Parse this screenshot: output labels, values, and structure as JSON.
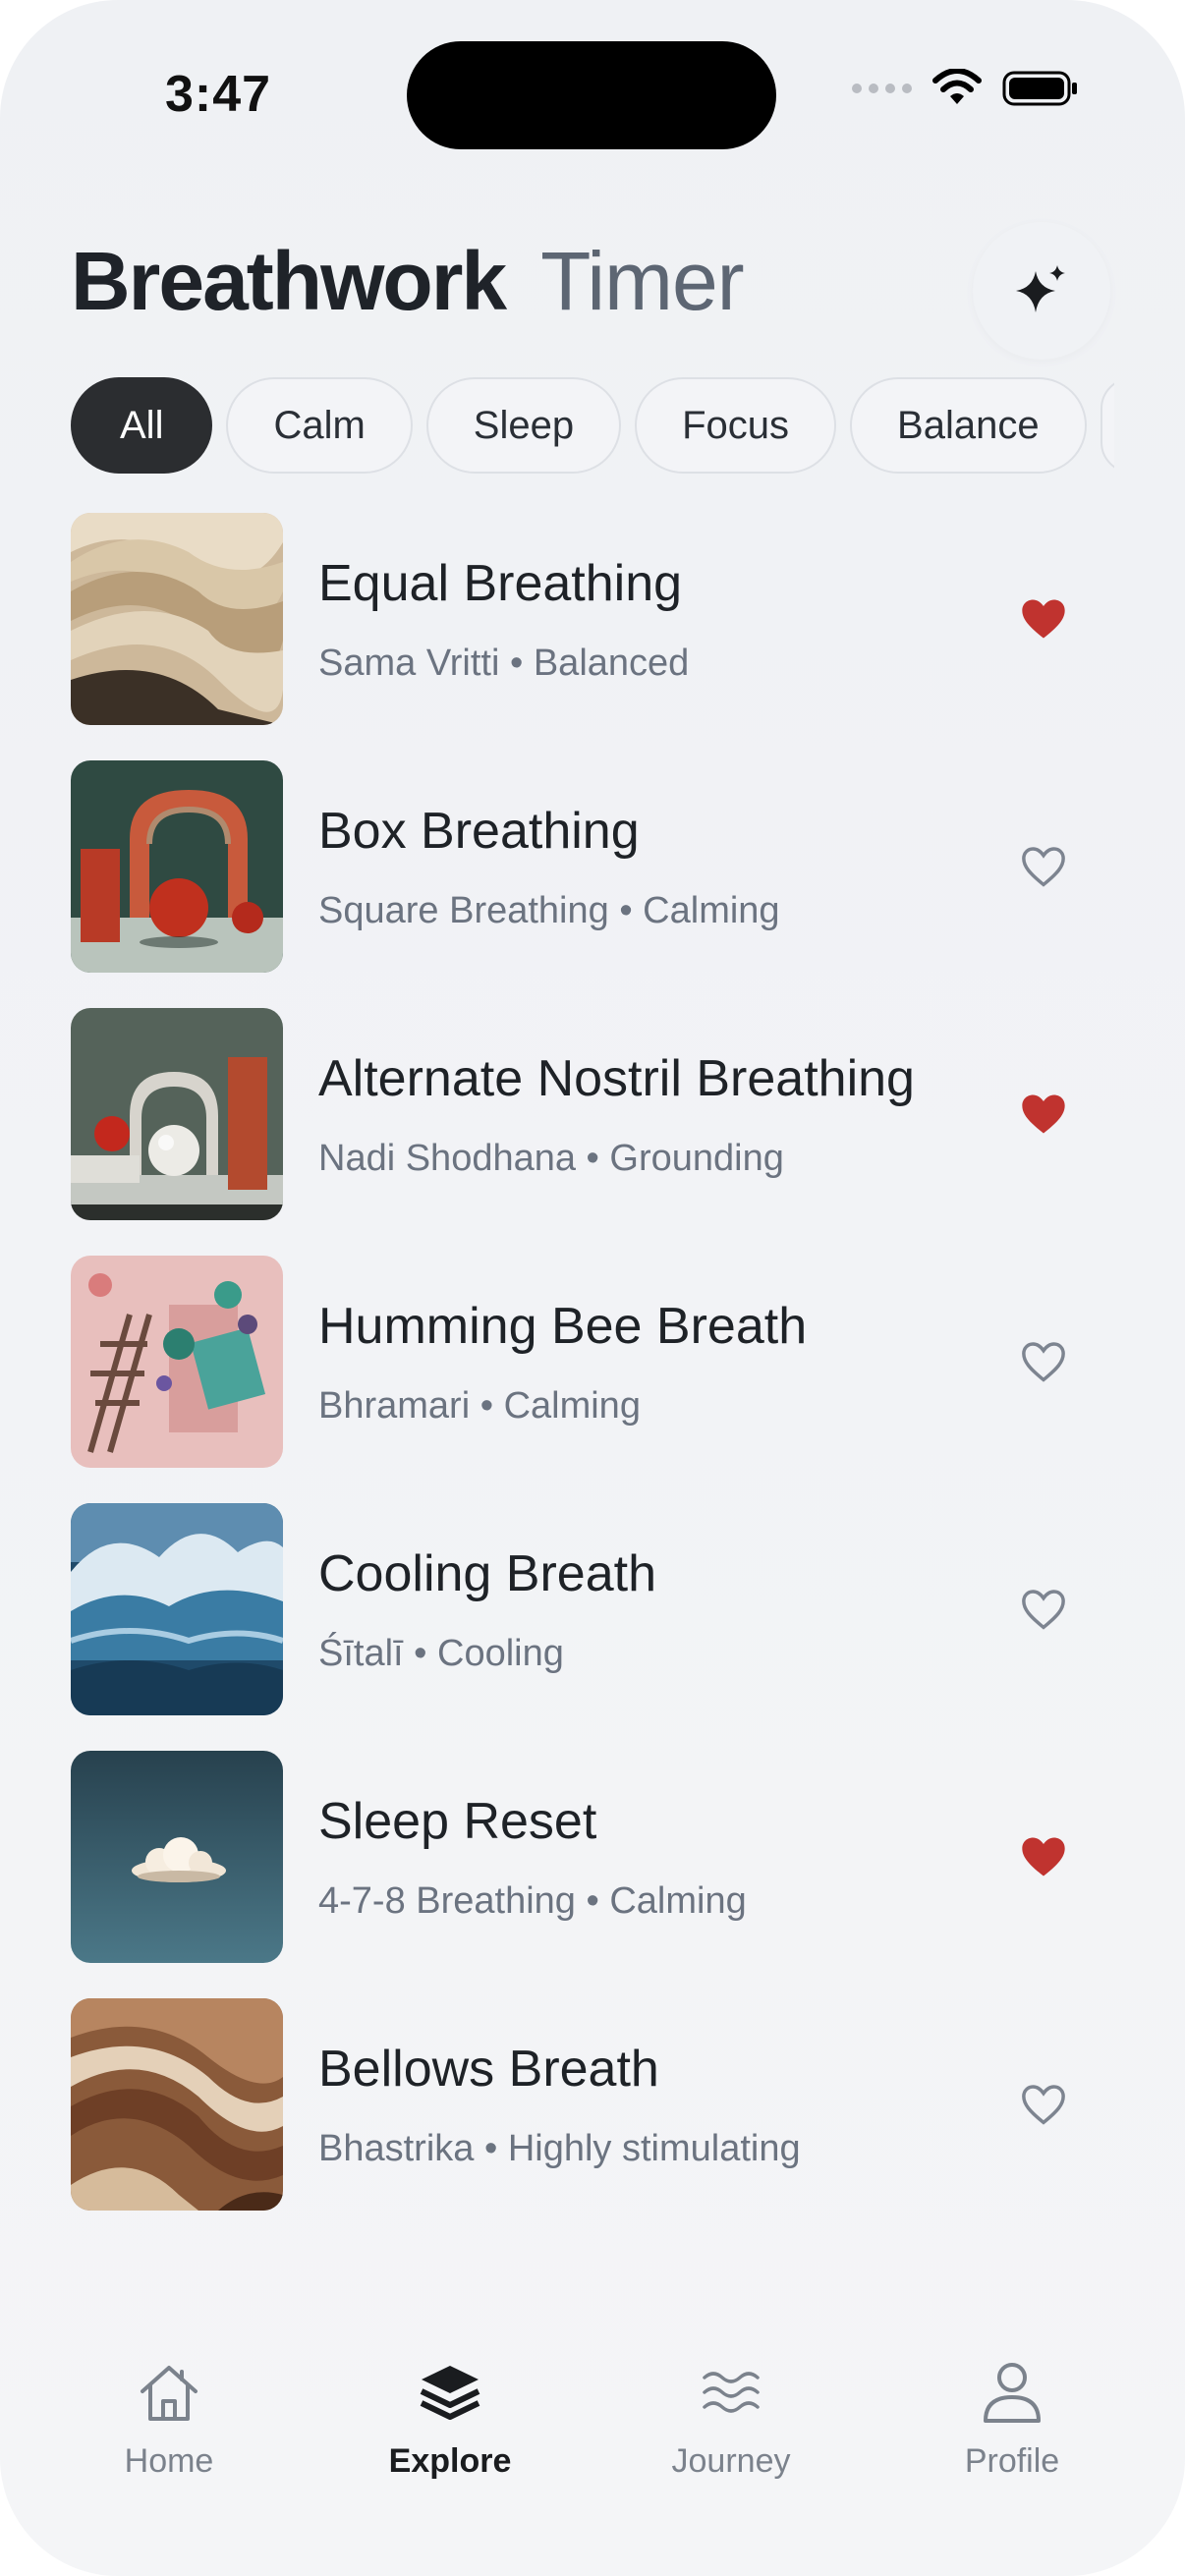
{
  "status_bar": {
    "time": "3:47"
  },
  "header": {
    "title": "Breathwork",
    "subtitle": "Timer",
    "action_icon": "sparkles-icon"
  },
  "chips": [
    {
      "label": "All",
      "active": true
    },
    {
      "label": "Calm"
    },
    {
      "label": "Sleep"
    },
    {
      "label": "Focus"
    },
    {
      "label": "Balance"
    }
  ],
  "exercises": [
    {
      "title": "Equal Breathing",
      "subtitle": "Sama Vritti • Balanced",
      "favorite": true
    },
    {
      "title": "Box Breathing",
      "subtitle": "Square Breathing • Calming",
      "favorite": false
    },
    {
      "title": "Alternate Nostril Breathing",
      "subtitle": "Nadi Shodhana • Grounding",
      "favorite": true
    },
    {
      "title": "Humming Bee Breath",
      "subtitle": "Bhramari • Calming",
      "favorite": false
    },
    {
      "title": "Cooling Breath",
      "subtitle": "Śītalī • Cooling",
      "favorite": false
    },
    {
      "title": "Sleep Reset",
      "subtitle": "4-7-8 Breathing • Calming",
      "favorite": true
    },
    {
      "title": "Bellows Breath",
      "subtitle": "Bhastrika • Highly stimulating",
      "favorite": false
    }
  ],
  "tabs": [
    {
      "label": "Home",
      "icon": "home-icon"
    },
    {
      "label": "Explore",
      "icon": "layers-icon",
      "active": true
    },
    {
      "label": "Journey",
      "icon": "waves-icon"
    },
    {
      "label": "Profile",
      "icon": "person-icon"
    }
  ],
  "colors": {
    "favorite": "#c0332f",
    "heart_outline": "#7d8490",
    "chip_active": "#2b2d30"
  }
}
